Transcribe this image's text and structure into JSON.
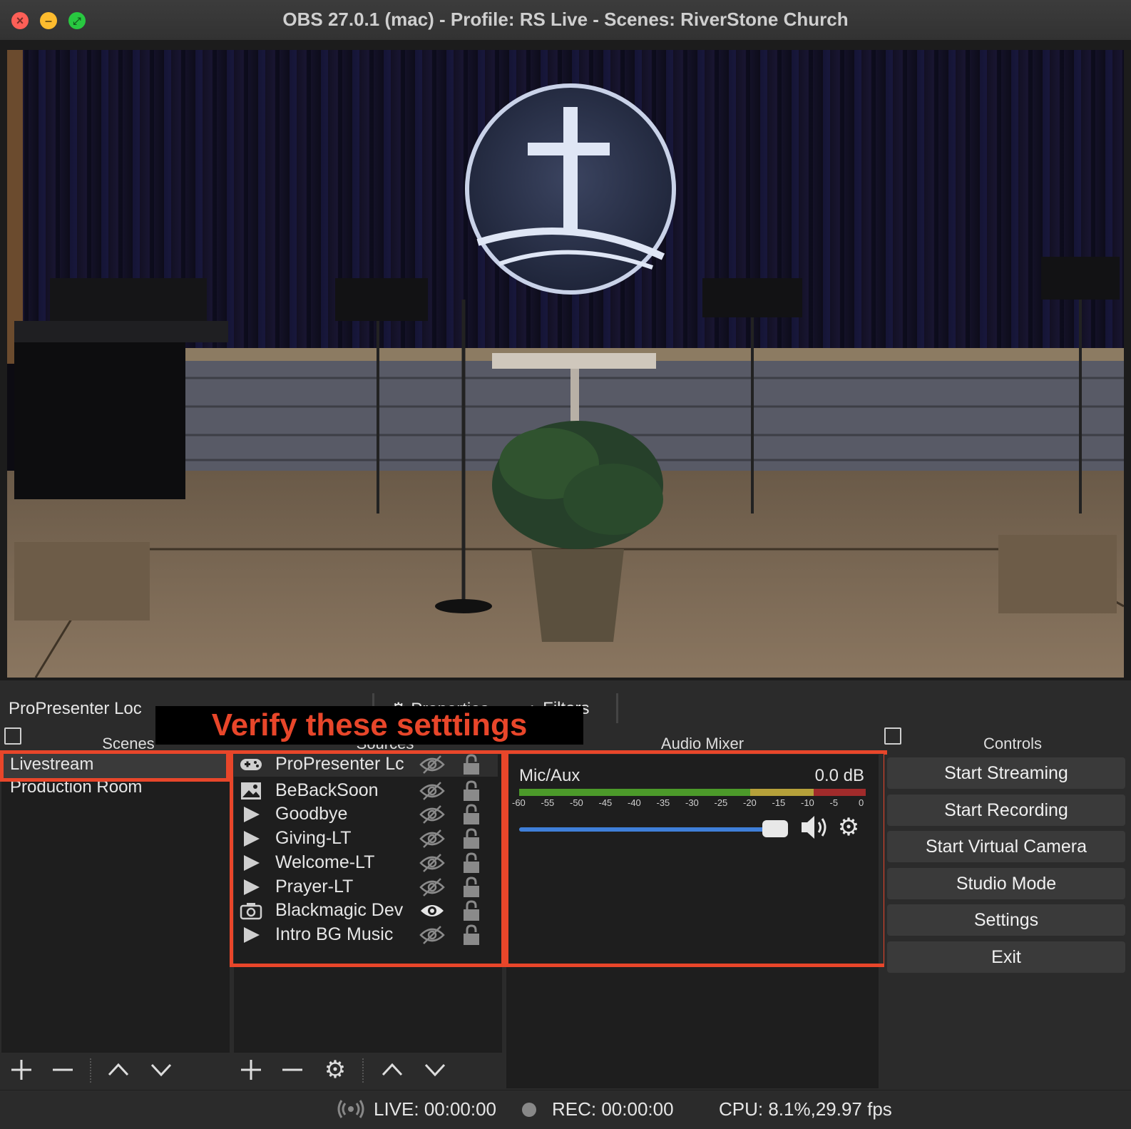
{
  "window": {
    "title": "OBS 27.0.1 (mac) - Profile: RS Live - Scenes: RiverStone Church"
  },
  "context_bar": {
    "source_name": "ProPresenter Loc",
    "properties_label": "Properties",
    "filters_label": "Filters"
  },
  "annotation": {
    "banner_text": "Verify these setttings"
  },
  "docks": {
    "scenes_title": "Scenes",
    "sources_title": "Sources",
    "mixer_title": "Audio Mixer",
    "controls_title": "Controls"
  },
  "scenes": [
    {
      "label": "Livestream",
      "selected": true
    },
    {
      "label": "Production Room",
      "selected": false
    }
  ],
  "sources": [
    {
      "label": "ProPresenter Lc",
      "icon": "gamepad-icon",
      "visible": false
    },
    {
      "label": "BeBackSoon",
      "icon": "image-icon",
      "visible": false
    },
    {
      "label": "Goodbye",
      "icon": "play-icon",
      "visible": false
    },
    {
      "label": "Giving-LT",
      "icon": "play-icon",
      "visible": false
    },
    {
      "label": "Welcome-LT",
      "icon": "play-icon",
      "visible": false
    },
    {
      "label": "Prayer-LT",
      "icon": "play-icon",
      "visible": false
    },
    {
      "label": "Blackmagic Dev",
      "icon": "camera-icon",
      "visible": true
    },
    {
      "label": "Intro BG Music",
      "icon": "play-icon",
      "visible": false
    }
  ],
  "mixer": {
    "channel_name": "Mic/Aux",
    "level": "0.0 dB",
    "meter_ticks": [
      "-60",
      "-55",
      "-50",
      "-45",
      "-40",
      "-35",
      "-30",
      "-25",
      "-20",
      "-15",
      "-10",
      "-5",
      "0"
    ],
    "fader_fraction": 0.97
  },
  "controls": [
    "Start Streaming",
    "Start Recording",
    "Start Virtual Camera",
    "Studio Mode",
    "Settings",
    "Exit"
  ],
  "status": {
    "live": "LIVE: 00:00:00",
    "rec": "REC: 00:00:00",
    "cpu": "CPU: 8.1%,29.97 fps"
  },
  "colors": {
    "annotation_red": "#e8462a",
    "fader_blue": "#3f7fd9",
    "meter_green": "#4c9a2a",
    "meter_yellow": "#b6a13a",
    "meter_red": "#a12b2b"
  }
}
